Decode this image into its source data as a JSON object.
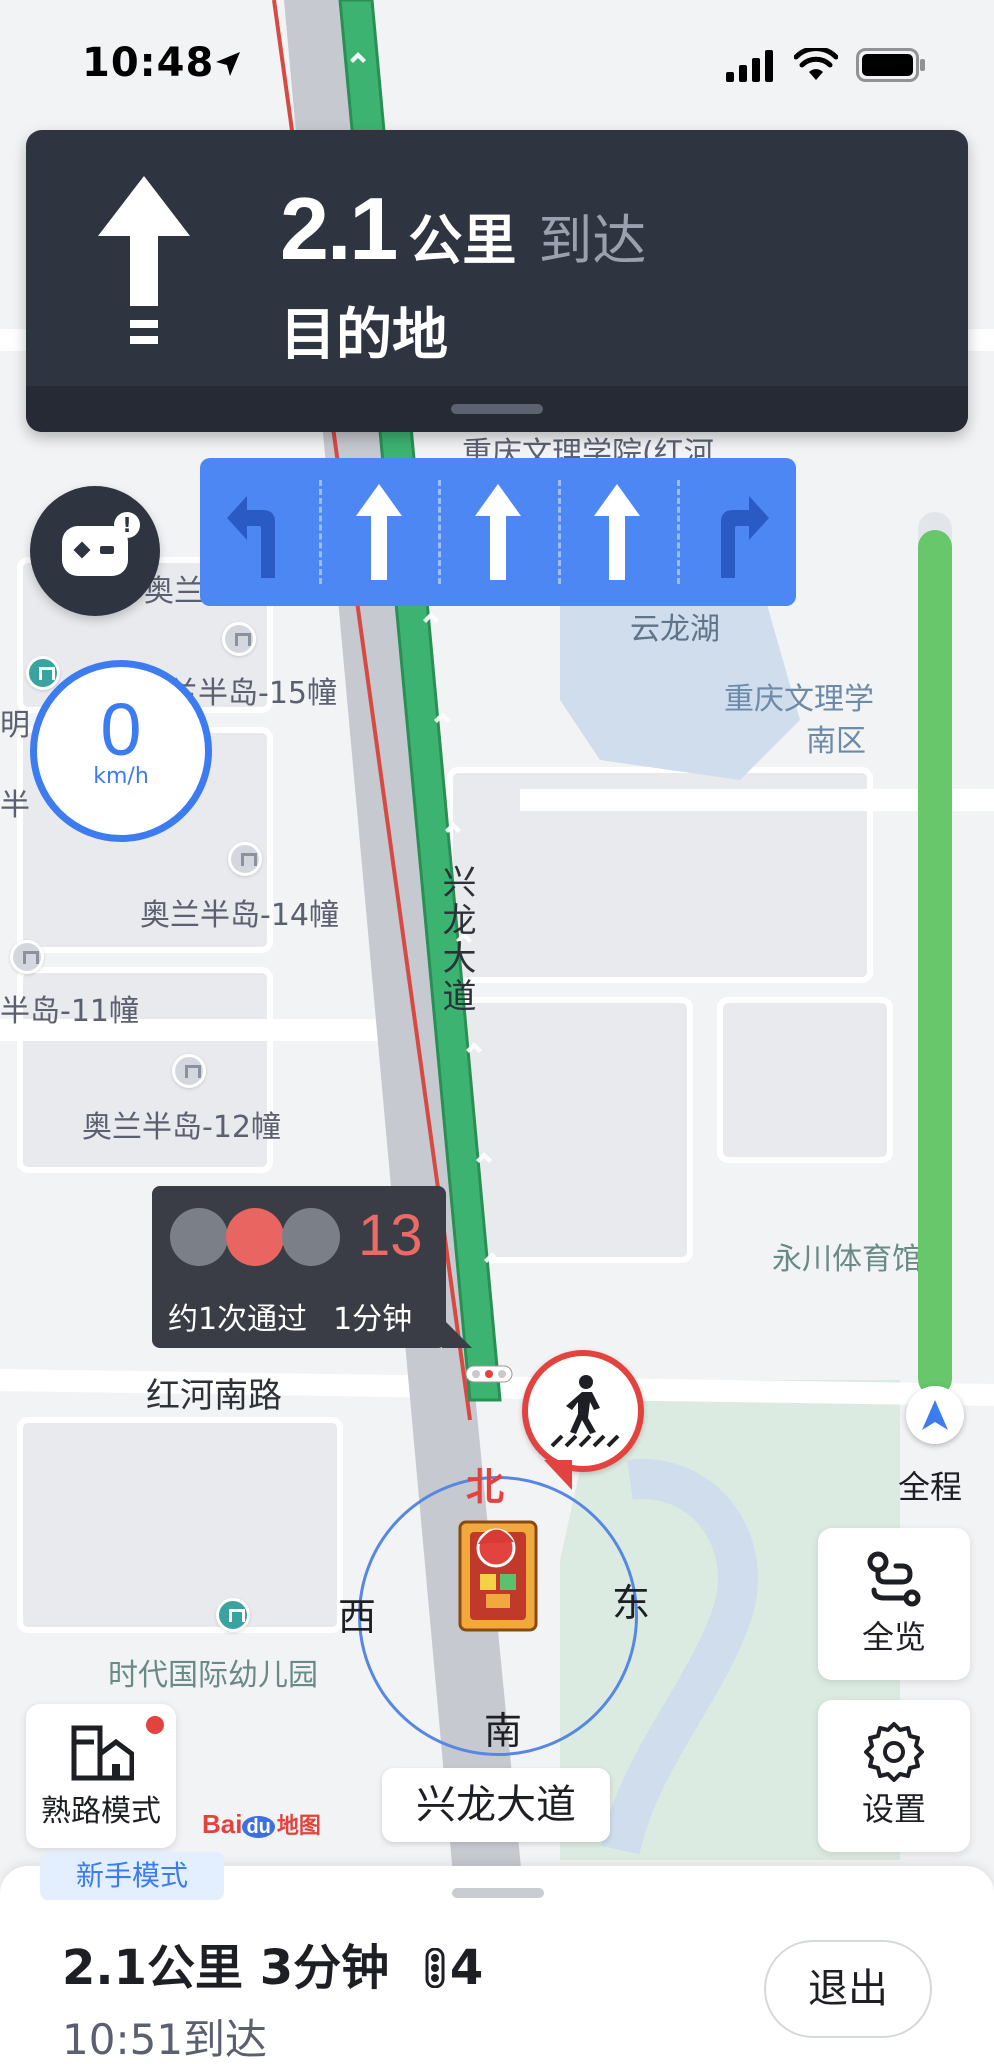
{
  "status_bar": {
    "time": "10:48"
  },
  "nav_banner": {
    "distance_value": "2.1",
    "distance_unit": "公里",
    "distance_suffix": "到达",
    "destination": "目的地"
  },
  "lane_guide": {
    "lanes": [
      "turn-left-arrow",
      "straight-arrow",
      "straight-arrow",
      "straight-arrow",
      "turn-right-arrow"
    ]
  },
  "speedometer": {
    "value": "0",
    "unit": "km/h"
  },
  "route_progress": {
    "remaining_fraction": 0.98,
    "label": "全程"
  },
  "traffic_light": {
    "countdown": "13",
    "pass_count": "约1次通过",
    "wait_time": "1分钟"
  },
  "compass": {
    "north": "北",
    "south": "南",
    "east": "东",
    "west": "西"
  },
  "map_labels": {
    "university": "重庆文理学院(红河",
    "lake": "云龙湖",
    "campus_line1": "重庆文理学",
    "campus_line2": "南区",
    "aolan_partial": "奥兰",
    "bldg_15": "兰半岛-15幢",
    "bldg_14": "奥兰半岛-14幢",
    "bldg_11": "半岛-11幢",
    "bldg_12": "奥兰半岛-12幢",
    "ming_partial": "明",
    "ban_partial": "半",
    "stadium": "永川体育馆",
    "road_honghe": "红河南路",
    "road_xinglong": "兴龙大道",
    "kindergarten": "时代国际幼儿园"
  },
  "buttons": {
    "overview": "全览",
    "settings": "设置",
    "familiar_mode": "熟路模式",
    "exit": "退出"
  },
  "current_road": "兴龙大道",
  "novice_mode": "新手模式",
  "logo": {
    "bai": "Bai",
    "du": "du",
    "ditu": "地图"
  },
  "trip": {
    "distance": "2.1公里",
    "duration": "3分钟",
    "lights": "4",
    "eta": "10:51到达"
  },
  "colors": {
    "banner": "#2f3441",
    "lane_blue": "#4d87f3",
    "route_green": "#3cb371",
    "progress_green": "#67c76a",
    "alert_red": "#e2433f",
    "accent_blue": "#3d7cf0"
  }
}
